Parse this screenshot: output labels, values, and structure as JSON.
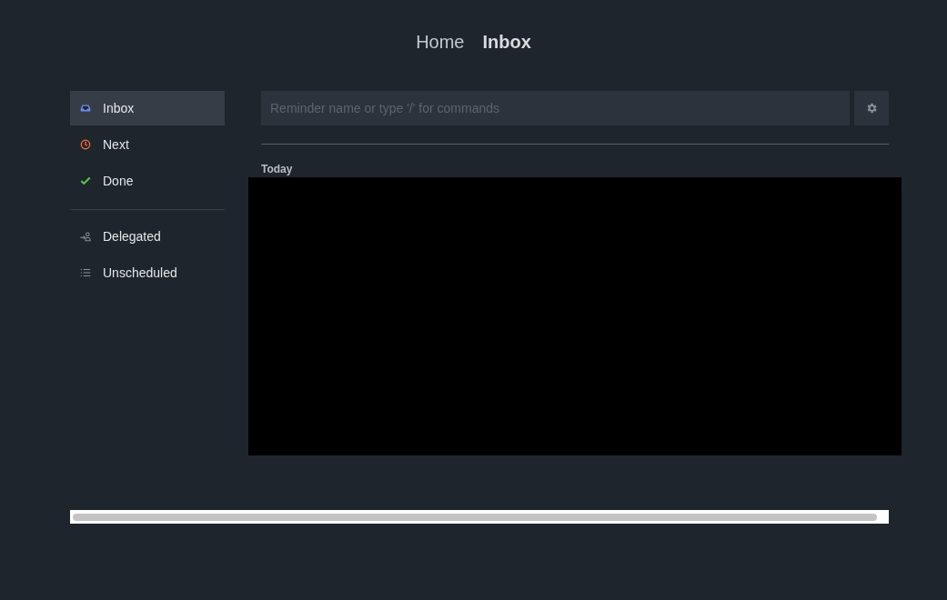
{
  "breadcrumb": [
    {
      "label": "Home",
      "selected": false
    },
    {
      "label": "Inbox",
      "selected": true
    }
  ],
  "sidebar": {
    "sections": [
      {
        "items": [
          {
            "kind": "inbox",
            "label": "Inbox",
            "selected": true
          },
          {
            "kind": "next",
            "label": "Next",
            "selected": false
          },
          {
            "kind": "done",
            "label": "Done",
            "selected": false
          }
        ]
      },
      {
        "items": [
          {
            "kind": "delegated",
            "label": "Delegated",
            "selected": false
          },
          {
            "kind": "list",
            "label": "Unscheduled",
            "selected": false
          }
        ]
      }
    ]
  },
  "reminder_input": {
    "placeholder": "Reminder name or type '/' for commands"
  },
  "groups": [
    {
      "heading": "Today"
    }
  ]
}
